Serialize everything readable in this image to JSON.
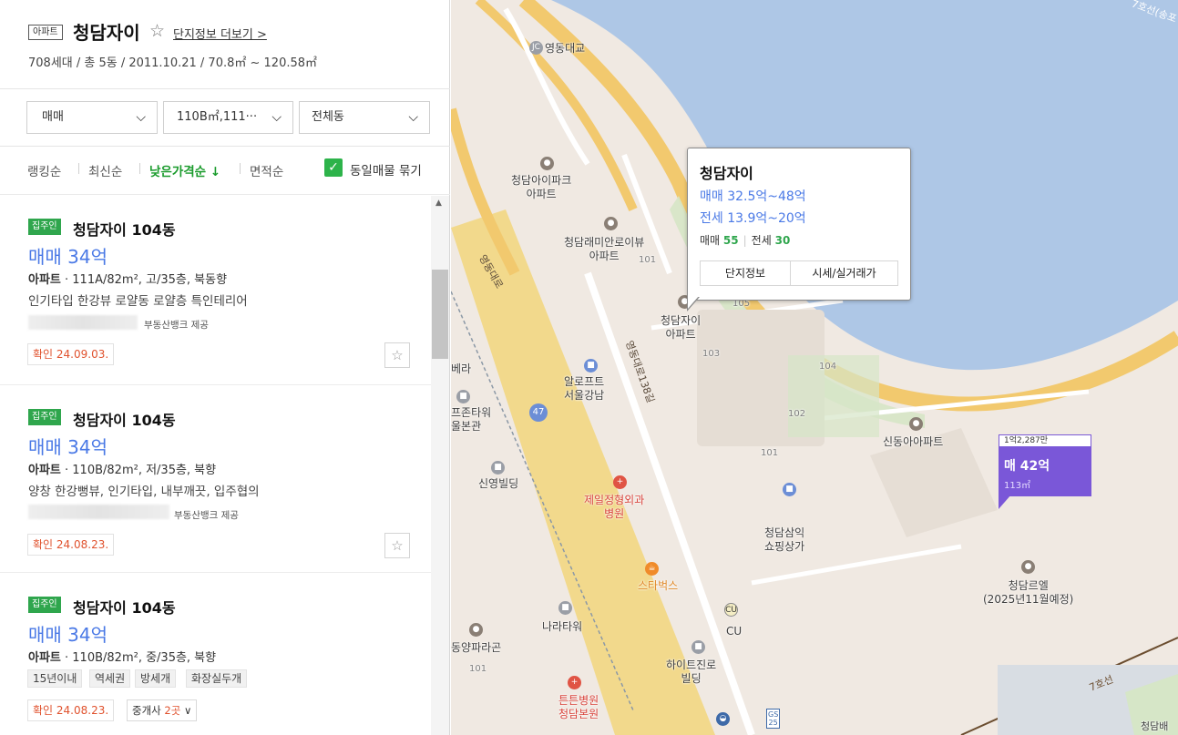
{
  "complex": {
    "type_chip": "아파트",
    "name": "청담자이",
    "more_link": "단지정보 더보기 >",
    "summary": "708세대 / 총 5동 / 2011.10.21 / 70.8㎡ ~ 120.58㎡"
  },
  "filters": {
    "trade_type": "매매",
    "area": "110B㎡,111···",
    "dong": "전체동"
  },
  "sort": {
    "items": [
      "랭킹순",
      "최신순",
      "낮은가격순 ↓",
      "면적순"
    ],
    "group_label": "동일매물 묶기"
  },
  "listings": [
    {
      "badge": "집주인",
      "title": "청담자이 104동",
      "price": "매매 34억",
      "spec_type": "아파트",
      "spec": " · 111A/82m², 고/35층, 북동향",
      "desc": "인기타입 한강뷰 로얄동 로얄층 특인테리어",
      "provider": "부동산뱅크 제공",
      "confirm": "확인 24.09.03."
    },
    {
      "badge": "집주인",
      "title": "청담자이 104동",
      "price": "매매 34억",
      "spec_type": "아파트",
      "spec": " · 110B/82m², 저/35층, 북향",
      "desc": "양창 한강뻥뷰, 인기타입, 내부깨끗, 입주협의",
      "provider": "부동산뱅크 제공",
      "confirm": "확인 24.08.23."
    },
    {
      "badge": "집주인",
      "title": "청담자이 104동",
      "price": "매매 34억",
      "spec_type": "아파트",
      "spec": " · 110B/82m², 중/35층, 북향",
      "tags": [
        "15년이내",
        "역세권",
        "방세개",
        "화장실두개"
      ],
      "confirm": "확인 24.08.23.",
      "agent_prefix": "중개사 ",
      "agent_count": "2곳",
      "agent_suffix": " ∨"
    }
  ],
  "map": {
    "popup": {
      "title": "청담자이",
      "sale_range": "매매 32.5억~48억",
      "jeonse_range": "전세 13.9억~20억",
      "sale_label": "매매",
      "sale_count": "55",
      "jeonse_label": "전세",
      "jeonse_count": "30",
      "btn_info": "단지정보",
      "btn_price": "시세/실거래가"
    },
    "marker": {
      "top": "1억2,287만",
      "price": "매 42억",
      "area": "113㎡"
    },
    "labels": {
      "jc": "영동대교",
      "jc_icon": "JC",
      "cheongdam_ipark": "청담아이파크\n아파트",
      "raemian": "청담래미안로이뷰\n아파트",
      "raemian_num": "101",
      "xi": "청담자이\n아파트",
      "aloft": "알로프트\n서울강남",
      "jeil": "제일정형외과\n병원",
      "starbucks": "스타벅스",
      "cu": "CU",
      "cu_icon": "CU",
      "narattower": "나라타워",
      "hitejinro": "하이트진로\n빌딩",
      "teunteun": "튼튼병원\n청담본원",
      "shinyoung": "신영빌딩",
      "shindong": "신동아아파트",
      "cheongdam_samik": "청담삼익\n쇼핑상가",
      "cheongdam_le_el": "청담르엘\n(2025년11월예정)",
      "dongyang": "동양파라곤",
      "dongyang_num": "101",
      "fusion": "프존타워\n울본관",
      "bera": "베라",
      "road_yeongdong": "영동대로",
      "road_138": "영동대로138길",
      "route_47": "47",
      "route_gs": "GS\n25",
      "line7": "7호선",
      "line7_top": "7호선(송포",
      "bldg_101": "101",
      "bldg_102": "102",
      "bldg_103": "103",
      "bldg_104": "104",
      "bldg_105": "105",
      "bldg_101b": "101",
      "cheongdam_corner": "청담배"
    },
    "colors": {
      "river": "#aec7e6",
      "land": "#f0e9e2",
      "road_major": "#f2c96e",
      "road_minor": "#ffffff",
      "green": "#d6e6c7",
      "accent_green": "#2fa64d",
      "price_blue": "#4a79e6",
      "marker_purple": "#7a57d8"
    }
  }
}
